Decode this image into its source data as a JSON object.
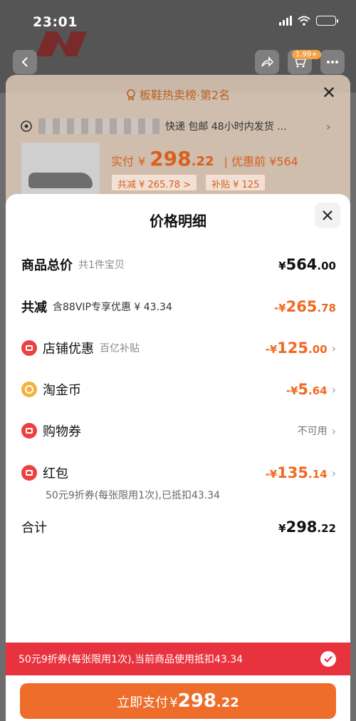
{
  "status_bar": {
    "time": "23:01"
  },
  "background": {
    "cart_badge": "1.99+",
    "sheet_title": "板鞋热卖榜·第2名",
    "address_text": "快递 包邮 48小时内发货 ...",
    "price_label": "实付",
    "price_currency": "¥",
    "price_int": "298",
    "price_dec": ".22",
    "orig_price": "| 优惠前 ¥564",
    "chip_discount": "共减 ¥ 265.78 >",
    "chip_subsidy": "补贴 ¥ 125"
  },
  "sheet": {
    "title": "价格明细",
    "rows": [
      {
        "label": "商品总价",
        "sub": "共1件宝贝",
        "cur": "¥",
        "int": "564",
        "dec": ".00"
      },
      {
        "label": "共减",
        "sub": "含88VIP专享优惠 ¥ 43.34",
        "cur": "-¥",
        "int": "265",
        "dec": ".78"
      },
      {
        "label": "店铺优惠",
        "sub": "百亿补贴",
        "cur": "-¥",
        "int": "125",
        "dec": ".00"
      },
      {
        "label": "淘金币",
        "sub": "",
        "cur": "-¥",
        "int": "5",
        "dec": ".64"
      },
      {
        "label": "购物券",
        "sub": "",
        "value_text": "不可用"
      },
      {
        "label": "红包",
        "sub": "",
        "cur": "-¥",
        "int": "135",
        "dec": ".14"
      },
      {
        "label": "合计",
        "sub": "",
        "cur": "¥",
        "int": "298",
        "dec": ".22"
      }
    ],
    "red_packet_note": "50元9折券(每张限用1次),已抵扣43.34"
  },
  "coupon_bar": {
    "text": "50元9折券(每张限用1次),当前商品使用抵扣43.34"
  },
  "pay_button": {
    "label": "立即支付",
    "cur": "¥",
    "int": "298",
    "dec": ".22"
  },
  "colors": {
    "accent_orange": "#ef6a22",
    "coupon_red": "#e8333f",
    "pay_button": "#ee6d2a"
  }
}
